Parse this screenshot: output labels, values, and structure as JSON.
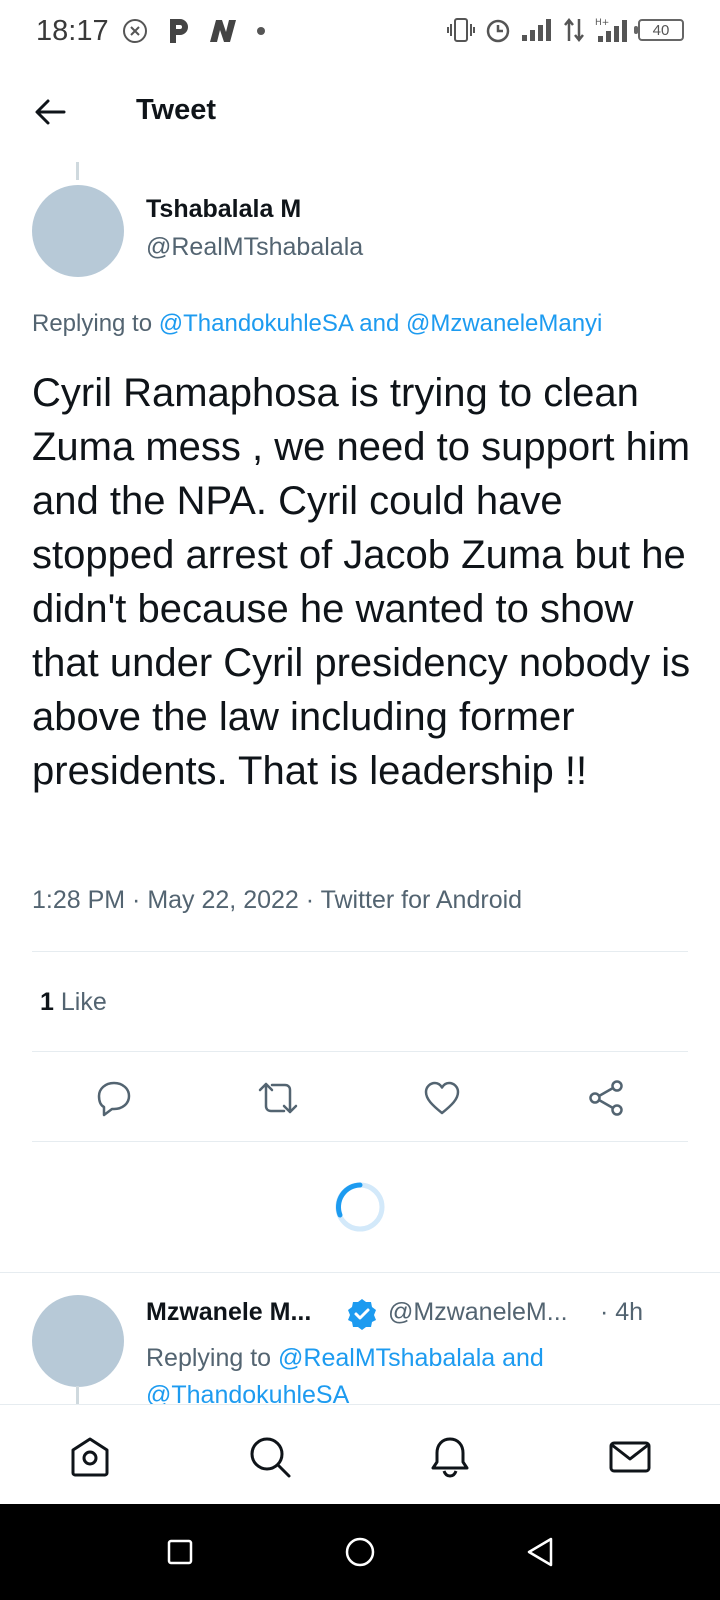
{
  "status_bar": {
    "time": "18:17",
    "battery": "40"
  },
  "header": {
    "title": "Tweet"
  },
  "tweet": {
    "author_name": "Tshabalala M",
    "author_handle": "@RealMTshabalala",
    "replying_prefix": "Replying to",
    "replying_targets": "@ThandokuhleSA and @MzwaneleManyi",
    "text": "Cyril Ramaphosa is trying to clean Zuma mess , we need to support him and the NPA. Cyril could have stopped arrest of Jacob Zuma but he didn't because he wanted to show that under Cyril presidency nobody is above the law including former presidents. That is leadership !!",
    "meta": "1:28 PM · May 22, 2022 · Twitter for Android",
    "like_count": "1",
    "like_label": "Like"
  },
  "reply": {
    "author_name": "Mzwanele M...",
    "author_handle": "@MzwaneleM...",
    "time": "· 4h",
    "replying_prefix": "Replying to",
    "replying_targets": "@RealMTshabalala and @ThandokuhleSA"
  },
  "colors": {
    "accent": "#1d9bf0",
    "avatar_placeholder": "#b7c9d7",
    "secondary_text": "#536471"
  }
}
